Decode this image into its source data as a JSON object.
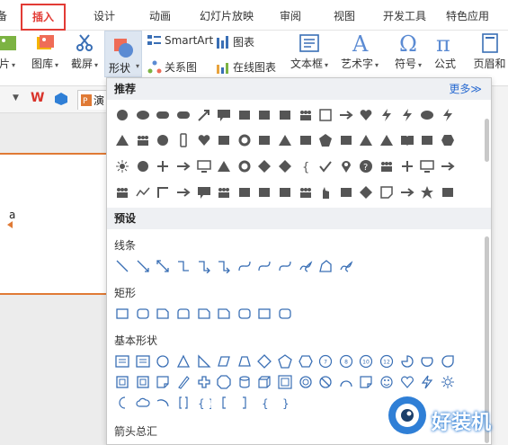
{
  "tabs": [
    "备",
    "插入",
    "设计",
    "动画",
    "幻灯片放映",
    "审阅",
    "视图",
    "开发工具",
    "特色应用"
  ],
  "ribbon": {
    "picture_tail": "片",
    "gallery": "图库",
    "screenshot": "截屏",
    "shape": "形状",
    "smartart": "SmartArt",
    "relation": "关系图",
    "chart": "图表",
    "online_chart": "在线图表",
    "textbox": "文本框",
    "wordart": "艺术字",
    "symbol": "符号",
    "formula": "公式",
    "header_footer": "页眉和"
  },
  "quickbar": {
    "tab_label": "演"
  },
  "slide": {
    "text": "a"
  },
  "panel": {
    "recommended": "推荐",
    "more": "更多≫",
    "preset": "预设",
    "lines": "线条",
    "rect": "矩形",
    "basic": "基本形状",
    "arrows": "箭头总汇"
  },
  "watermark": {
    "text": "好装机"
  },
  "colors": {
    "accent": "#e23b35",
    "link": "#2a6bd1",
    "icon_blue": "#3a6fb5"
  }
}
